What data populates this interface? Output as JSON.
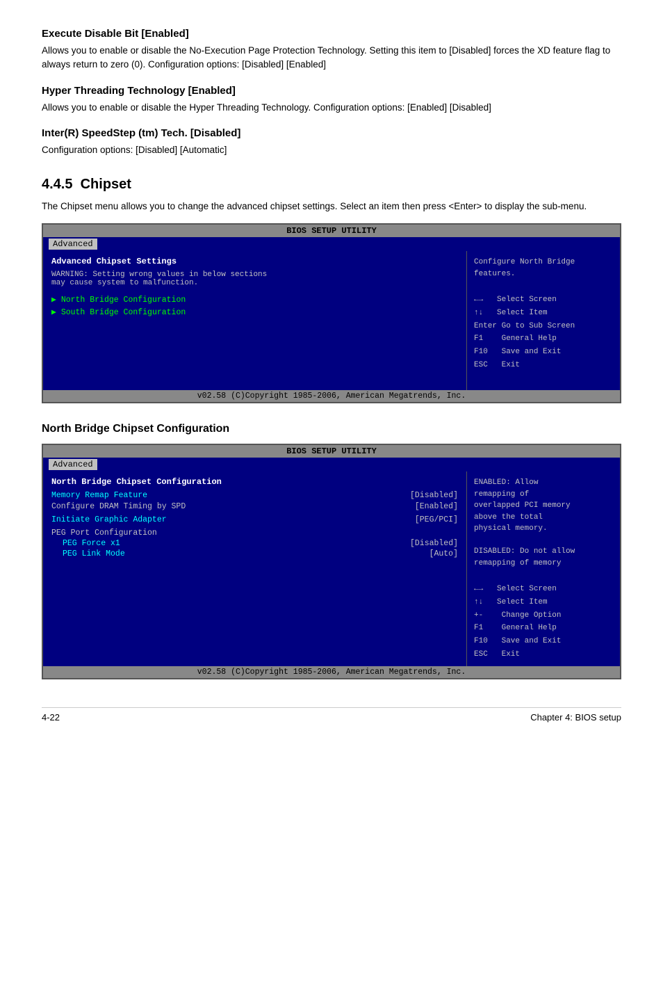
{
  "sections": [
    {
      "id": "execute-disable",
      "title": "Execute Disable Bit [Enabled]",
      "body": "Allows you to enable or disable the No-Execution Page Protection Technology. Setting this item to [Disabled] forces the XD feature flag to always return to zero (0). Configuration options: [Disabled] [Enabled]"
    },
    {
      "id": "hyper-threading",
      "title": "Hyper Threading Technology [Enabled]",
      "body": "Allows you to enable or disable the Hyper Threading Technology. Configuration options: [Enabled] [Disabled]"
    },
    {
      "id": "speedstep",
      "title": "Inter(R) SpeedStep (tm) Tech. [Disabled]",
      "body": "Configuration options: [Disabled] [Automatic]"
    }
  ],
  "chipset": {
    "section_number": "4.4.5",
    "section_title": "Chipset",
    "intro": "The Chipset menu allows you to change the advanced chipset settings. Select an item then press <Enter> to display the sub-menu.",
    "bios1": {
      "title_bar": "BIOS SETUP UTILITY",
      "active_tab": "Advanced",
      "left_header": "Advanced Chipset Settings",
      "warning_line1": "WARNING: Setting wrong values in below sections",
      "warning_line2": "         may cause system to malfunction.",
      "menu_items": [
        "North Bridge Configuration",
        "South Bridge Configuration"
      ],
      "right_text": "Configure North Bridge\nfeatures.",
      "keys": [
        {
          "key": "←→",
          "desc": "Select Screen"
        },
        {
          "key": "↑↓",
          "desc": "Select Item"
        },
        {
          "key": "Enter",
          "desc": "Go to Sub Screen"
        },
        {
          "key": "F1",
          "desc": "General Help"
        },
        {
          "key": "F10",
          "desc": "Save and Exit"
        },
        {
          "key": "ESC",
          "desc": "Exit"
        }
      ],
      "footer": "v02.58 (C)Copyright 1985-2006, American Megatrends, Inc."
    }
  },
  "north_bridge": {
    "heading": "North Bridge Chipset Configuration",
    "bios2": {
      "title_bar": "BIOS SETUP UTILITY",
      "active_tab": "Advanced",
      "left_header": "North Bridge Chipset Configuration",
      "rows": [
        {
          "label": "Memory Remap Feature",
          "value": "[Disabled]",
          "highlight": true
        },
        {
          "label": "Configure DRAM Timing by SPD",
          "value": "[Enabled]",
          "highlight": false
        },
        {
          "label": "Initiate Graphic Adapter",
          "value": "[PEG/PCI]",
          "highlight": true
        },
        {
          "label": "PEG Port Configuration",
          "value": "",
          "highlight": false
        }
      ],
      "subitems": [
        {
          "label": "PEG Force x1",
          "value": "[Disabled]"
        },
        {
          "label": "PEG Link Mode",
          "value": "[Auto]"
        }
      ],
      "right_text": "ENABLED: Allow\nremapping of\noverlapped PCI memory\nabove the total\nphysical memory.\n\nDISABLED: Do not allow\nremapping of memory",
      "keys": [
        {
          "key": "←→",
          "desc": "Select Screen"
        },
        {
          "key": "↑↓",
          "desc": "Select Item"
        },
        {
          "key": "+-",
          "desc": "Change Option"
        },
        {
          "key": "F1",
          "desc": "General Help"
        },
        {
          "key": "F10",
          "desc": "Save and Exit"
        },
        {
          "key": "ESC",
          "desc": "Exit"
        }
      ],
      "footer": "v02.58 (C)Copyright 1985-2006, American Megatrends, Inc."
    }
  },
  "page_footer": {
    "page_number": "4-22",
    "chapter_label": "Chapter 4: BIOS setup"
  }
}
